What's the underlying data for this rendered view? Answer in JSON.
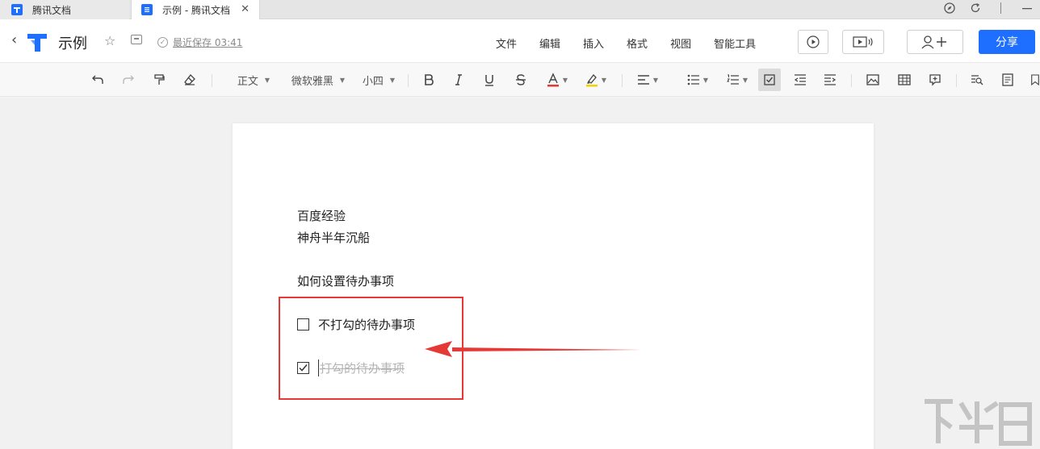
{
  "tabs": [
    {
      "label": "腾讯文档",
      "active": false
    },
    {
      "label": "示例 - 腾讯文档",
      "active": true
    }
  ],
  "header": {
    "doc_title": "示例",
    "save_status": "最近保存 03:41",
    "menu": [
      "文件",
      "编辑",
      "插入",
      "格式",
      "视图",
      "智能工具"
    ],
    "share_label": "分享"
  },
  "toolbar": {
    "style": "正文",
    "font": "微软雅黑",
    "size": "小四"
  },
  "document": {
    "lines": [
      "百度经验",
      "神舟半年沉船",
      "如何设置待办事项"
    ],
    "todos": [
      {
        "text": "不打勾的待办事项",
        "checked": false
      },
      {
        "text": "打勾的待办事项",
        "checked": true
      }
    ]
  },
  "colors": {
    "brand_blue": "#1e6fff",
    "annotation_red": "#e53935",
    "done_text": "#b3b3b3"
  }
}
